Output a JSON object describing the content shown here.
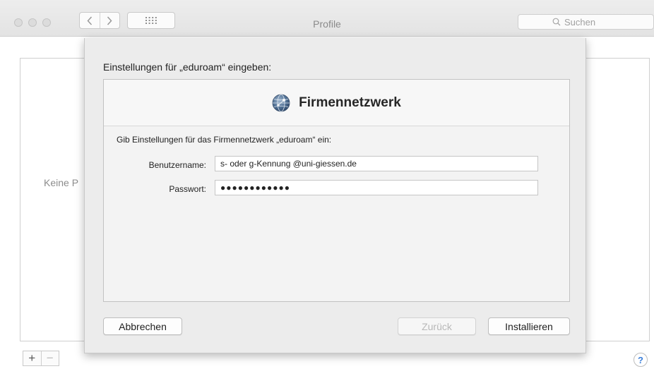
{
  "window": {
    "title": "Profile",
    "search_placeholder": "Suchen"
  },
  "background": {
    "empty_text": "Keine P",
    "add_label": "+",
    "remove_label": "−",
    "help_label": "?"
  },
  "sheet": {
    "title": "Einstellungen für „eduroam“ eingeben:",
    "heading": "Firmennetzwerk",
    "instruction": "Gib Einstellungen für das Firmennetzwerk „eduroam“ ein:",
    "username_label": "Benutzername:",
    "username_value": "s- oder g-Kennung @uni-giessen.de",
    "password_label": "Passwort:",
    "password_value": "●●●●●●●●●●●●",
    "cancel_label": "Abbrechen",
    "back_label": "Zurück",
    "install_label": "Installieren"
  },
  "icons": {
    "heading_icon": "globe-network-icon",
    "search": "magnifier-icon"
  }
}
